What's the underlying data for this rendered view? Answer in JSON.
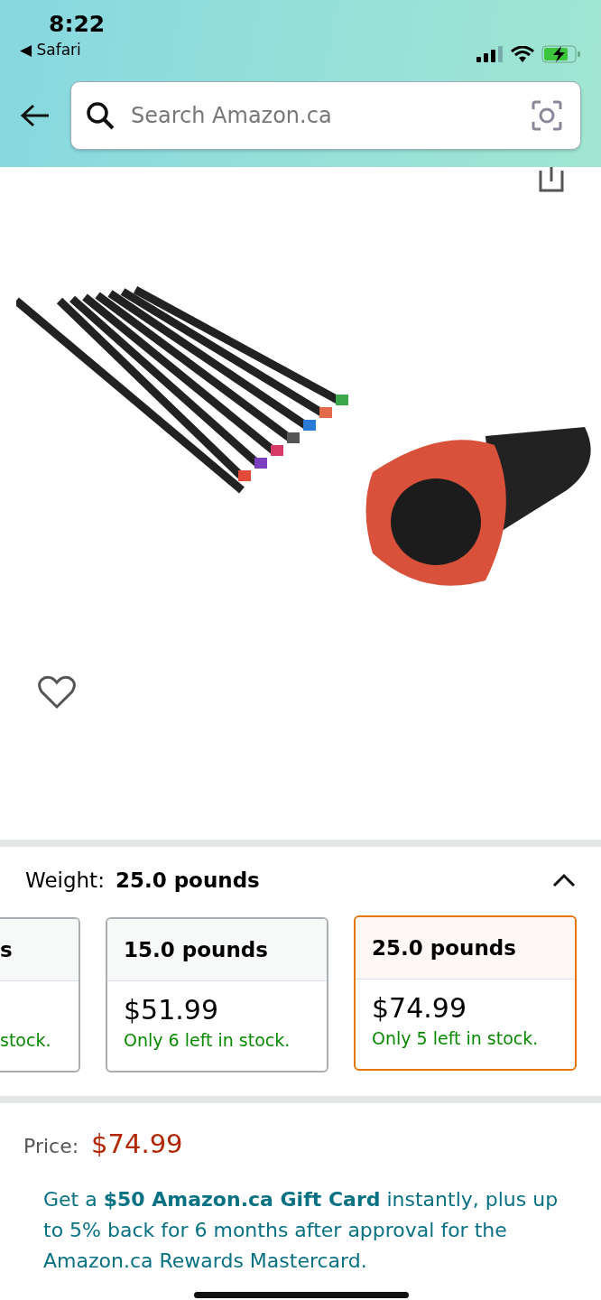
{
  "status_bar": {
    "time": "8:22",
    "back_app": "◀ Safari"
  },
  "search": {
    "placeholder": "Search Amazon.ca"
  },
  "product": {
    "favorite": false
  },
  "variation": {
    "label": "Weight:",
    "value": "25.0 pounds",
    "expanded": true,
    "options": [
      {
        "kind": "cut",
        "title": "s",
        "stock": "stock.",
        "selected": false
      },
      {
        "kind": "full",
        "title": "15.0 pounds",
        "price": "$51.99",
        "stock": "Only 6 left in stock.",
        "selected": false
      },
      {
        "kind": "full",
        "title": "25.0 pounds",
        "price": "$74.99",
        "stock": "Only 5 left in stock.",
        "selected": true
      }
    ]
  },
  "price": {
    "label": "Price:",
    "value": "$74.99"
  },
  "promo": "Get a **$50 Amazon.ca Gift Card** instantly, plus up to 5% back for 6 months after approval for the Amazon.ca Rewards Mastercard."
}
